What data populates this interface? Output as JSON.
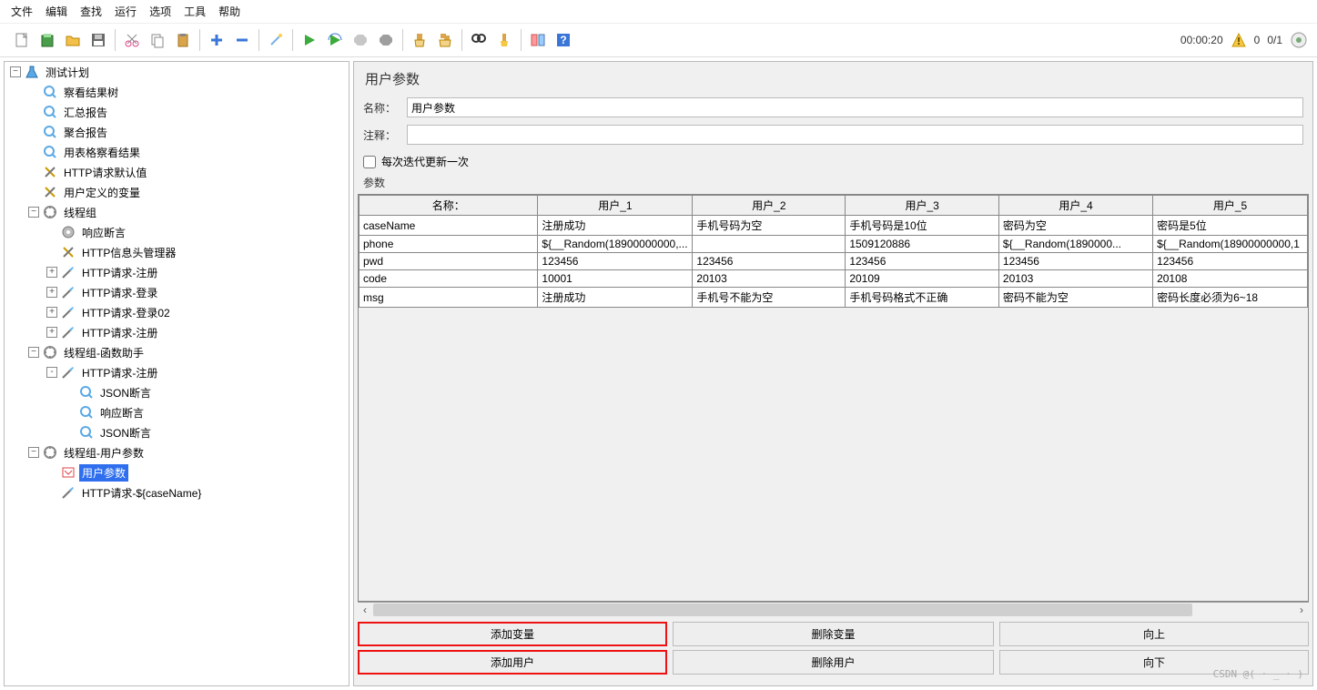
{
  "menu": [
    "文件",
    "编辑",
    "查找",
    "运行",
    "选项",
    "工具",
    "帮助"
  ],
  "toolbar": {
    "icons": [
      "new",
      "templates",
      "open",
      "save",
      "cut",
      "copy",
      "paste",
      "add",
      "remove",
      "wand",
      "run",
      "run-loop",
      "stop",
      "stop-hard",
      "clear",
      "clear-all",
      "find",
      "brush",
      "toggle",
      "help"
    ],
    "time": "00:00:20",
    "warn_count": "0",
    "run_ratio": "0/1"
  },
  "tree": {
    "root": "测试计划",
    "nodes": [
      {
        "icon": "Q",
        "label": "察看结果树"
      },
      {
        "icon": "Q",
        "label": "汇总报告"
      },
      {
        "icon": "Q",
        "label": "聚合报告"
      },
      {
        "icon": "Q",
        "label": "用表格察看结果"
      },
      {
        "icon": "X",
        "label": "HTTP请求默认值"
      },
      {
        "icon": "X",
        "label": "用户定义的变量"
      }
    ],
    "threadgroup1": {
      "label": "线程组",
      "children": [
        {
          "icon": "G",
          "label": "响应断言",
          "toggle": ""
        },
        {
          "icon": "X",
          "label": "HTTP信息头管理器",
          "toggle": ""
        },
        {
          "icon": "P",
          "label": "HTTP请求-注册",
          "toggle": "+"
        },
        {
          "icon": "P",
          "label": "HTTP请求-登录",
          "toggle": "+"
        },
        {
          "icon": "P",
          "label": "HTTP请求-登录02",
          "toggle": "+"
        },
        {
          "icon": "P",
          "label": "HTTP请求-注册",
          "toggle": "+"
        }
      ]
    },
    "threadgroup2": {
      "label": "线程组-函数助手",
      "children": [
        {
          "icon": "P",
          "label": "HTTP请求-注册",
          "toggle": "-",
          "children": [
            {
              "icon": "Q",
              "label": "JSON断言"
            },
            {
              "icon": "Q",
              "label": "响应断言"
            },
            {
              "icon": "Q",
              "label": "JSON断言"
            }
          ]
        }
      ]
    },
    "threadgroup3": {
      "label": "线程组-用户参数",
      "children": [
        {
          "icon": "U",
          "label": "用户参数",
          "selected": true
        },
        {
          "icon": "P",
          "label": "HTTP请求-${caseName}"
        }
      ]
    }
  },
  "panel": {
    "title": "用户参数",
    "name_label": "名称：",
    "name_value": "用户参数",
    "comment_label": "注释：",
    "comment_value": "",
    "checkbox_label": "每次迭代更新一次",
    "checkbox_checked": false,
    "params_label": "参数",
    "watermark": "CSDN @( · _ · )"
  },
  "grid": {
    "name_header": "名称：",
    "user_headers": [
      "用户_1",
      "用户_2",
      "用户_3",
      "用户_4",
      "用户_5"
    ],
    "rows": [
      {
        "n": "caseName",
        "c": [
          "注册成功",
          "手机号码为空",
          "手机号码是10位",
          "密码为空",
          "密码是5位"
        ]
      },
      {
        "n": "phone",
        "c": [
          "${__Random(18900000000,...",
          "",
          "1509120886",
          "${__Random(1890000...",
          "${__Random(18900000000,1"
        ]
      },
      {
        "n": "pwd",
        "c": [
          "123456",
          "123456",
          "123456",
          "123456",
          "123456"
        ]
      },
      {
        "n": "code",
        "c": [
          "10001",
          "20103",
          "20109",
          "20103",
          "20108"
        ]
      },
      {
        "n": "msg",
        "c": [
          "注册成功",
          "手机号不能为空",
          "手机号码格式不正确",
          "密码不能为空",
          "密码长度必须为6~18"
        ]
      }
    ]
  },
  "chart_data": {
    "type": "table",
    "title": "参数",
    "headers": [
      "名称：",
      "用户_1",
      "用户_2",
      "用户_3",
      "用户_4",
      "用户_5"
    ],
    "rows": [
      [
        "caseName",
        "注册成功",
        "手机号码为空",
        "手机号码是10位",
        "密码为空",
        "密码是5位"
      ],
      [
        "phone",
        "${__Random(18900000000,...",
        "",
        "1509120886",
        "${__Random(1890000...",
        "${__Random(18900000000,1"
      ],
      [
        "pwd",
        "123456",
        "123456",
        "123456",
        "123456",
        "123456"
      ],
      [
        "code",
        "10001",
        "20103",
        "20109",
        "20103",
        "20108"
      ],
      [
        "msg",
        "注册成功",
        "手机号不能为空",
        "手机号码格式不正确",
        "密码不能为空",
        "密码长度必须为6~18"
      ]
    ]
  },
  "buttons": {
    "add_var": "添加变量",
    "del_var": "删除变量",
    "up": "向上",
    "add_user": "添加用户",
    "del_user": "删除用户",
    "down": "向下"
  }
}
